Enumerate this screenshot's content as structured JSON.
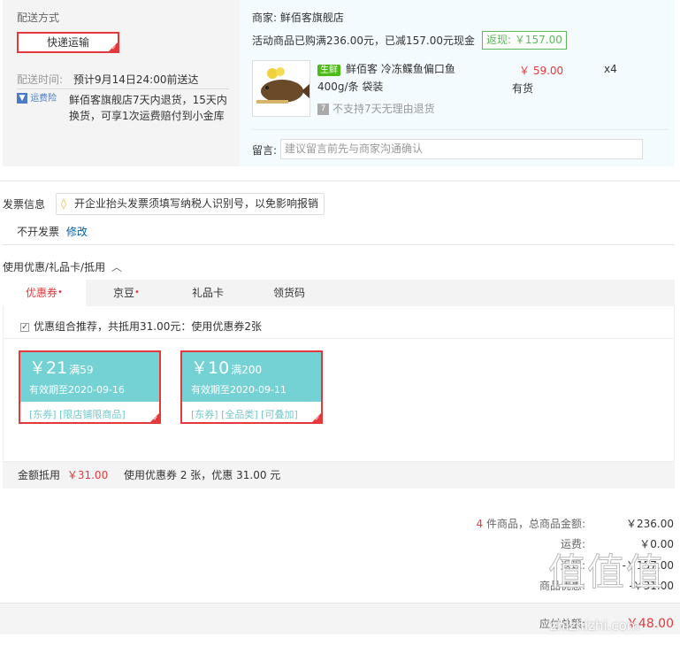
{
  "delivery": {
    "title": "配送方式",
    "method": "快递运输",
    "time_label": "配送时间:",
    "time_value": "预计9月14日24:00前送达",
    "insurance_badge": "运费险",
    "insurance_text_1": "鲜佰客旗舰店7天内退货，15天内",
    "insurance_text_2": "换货，可享1次运费赔付到小金库"
  },
  "shop": {
    "merchant_label": "商家:",
    "merchant_name": "鲜佰客旗舰店",
    "promo_text": "活动商品已购满236.00元，已减157.00元现金",
    "rebate_badge": "返现: ￥157.00",
    "product": {
      "fresh_tag": "生鲜",
      "name_1": "鲜佰客 冷冻鲽鱼偏口鱼",
      "name_2": "400g/条 袋装",
      "price": "￥ 59.00",
      "quantity": "x4",
      "stock": "有货",
      "return_policy": "不支持7天无理由退货"
    },
    "note_label": "留言:",
    "note_placeholder": "建议留言前先与商家沟通确认"
  },
  "invoice": {
    "title": "发票信息",
    "tip": "开企业抬头发票须填写纳税人识别号，以免影响报销",
    "value": "不开发票",
    "modify_link": "修改"
  },
  "discount": {
    "title": "使用优惠/礼品卡/抵用",
    "tabs": [
      {
        "label": "优惠券",
        "dot": true
      },
      {
        "label": "京豆",
        "dot": true
      },
      {
        "label": "礼品卡",
        "dot": false
      },
      {
        "label": "领货码",
        "dot": false
      }
    ],
    "combo_text": "优惠组合推荐，共抵用31.00元：使用优惠券2张",
    "coupons": [
      {
        "amount": "￥21",
        "condition": "满59",
        "valid": "有效期至2020-09-16",
        "tags": "[东券] [限店铺限商品]"
      },
      {
        "amount": "￥10",
        "condition": "满200",
        "valid": "有效期至2020-09-11",
        "tags": "[东券] [全品类] [可叠加]"
      }
    ],
    "summary_label": "金额抵用",
    "summary_amount": "￥31.00",
    "summary_detail": "使用优惠券 2 张，优惠 31.00 元"
  },
  "totals": {
    "count": "4",
    "goods_label": "件商品，总商品金额:",
    "goods_amount": "￥236.00",
    "shipping_label": "运费:",
    "shipping_amount": "￥0.00",
    "rebate_label": "返现:",
    "rebate_amount": "-￥157.00",
    "discount_label": "商品优惠:",
    "discount_amount": "-￥31.00",
    "payable_label": "应付总额:",
    "payable_amount": "￥48.00"
  },
  "watermark": {
    "text": "值值值",
    "url": "zhizhizhi.com"
  },
  "colors": {
    "accent": "#e4393c",
    "coupon": "#74d2d4",
    "fresh": "#4cbb17",
    "rebate": "#5cb85c"
  }
}
